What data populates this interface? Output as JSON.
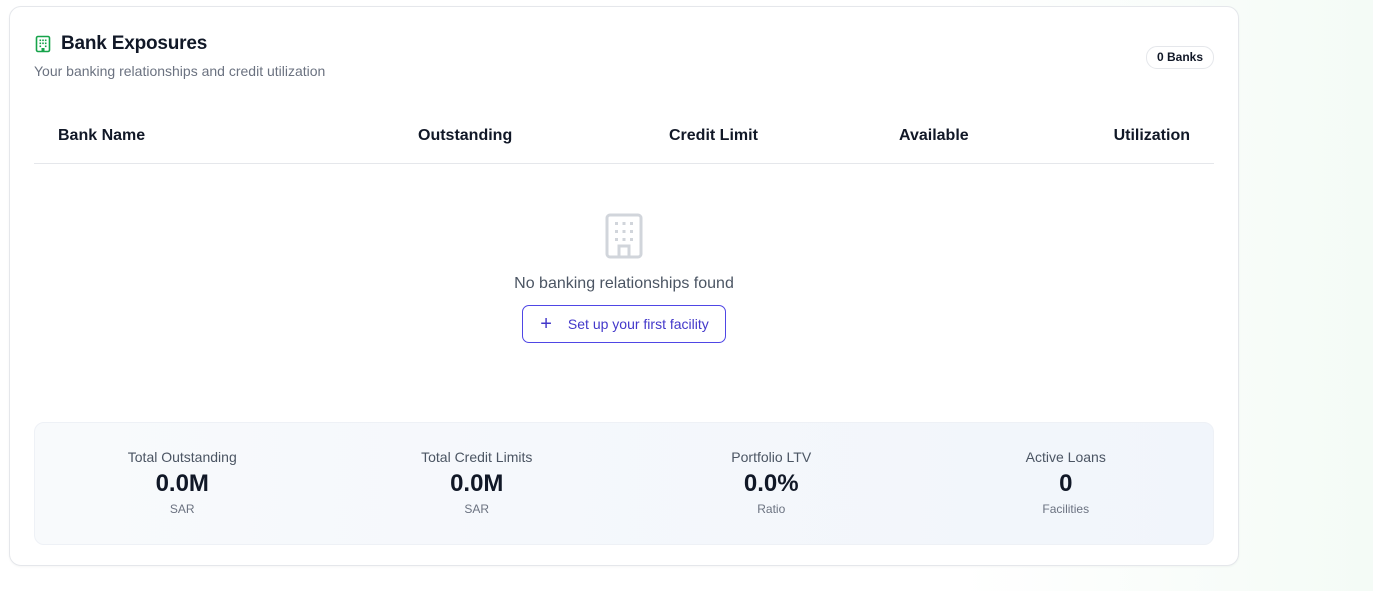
{
  "card": {
    "title": "Bank Exposures",
    "title_icon": "building-icon",
    "subtitle": "Your banking relationships and credit utilization",
    "badge": "0 Banks",
    "accent_color": "#16a34a"
  },
  "table": {
    "columns": [
      "Bank Name",
      "Outstanding",
      "Credit Limit",
      "Available",
      "Utilization"
    ],
    "rows": []
  },
  "empty_state": {
    "icon": "building-icon",
    "message": "No banking relationships found",
    "button_label": "Set up your first facility",
    "button_icon": "plus-icon",
    "button_color": "#4338ca"
  },
  "summary": [
    {
      "label": "Total Outstanding",
      "value": "0.0M",
      "unit": "SAR"
    },
    {
      "label": "Total Credit Limits",
      "value": "0.0M",
      "unit": "SAR"
    },
    {
      "label": "Portfolio LTV",
      "value": "0.0%",
      "unit": "Ratio"
    },
    {
      "label": "Active Loans",
      "value": "0",
      "unit": "Facilities"
    }
  ]
}
